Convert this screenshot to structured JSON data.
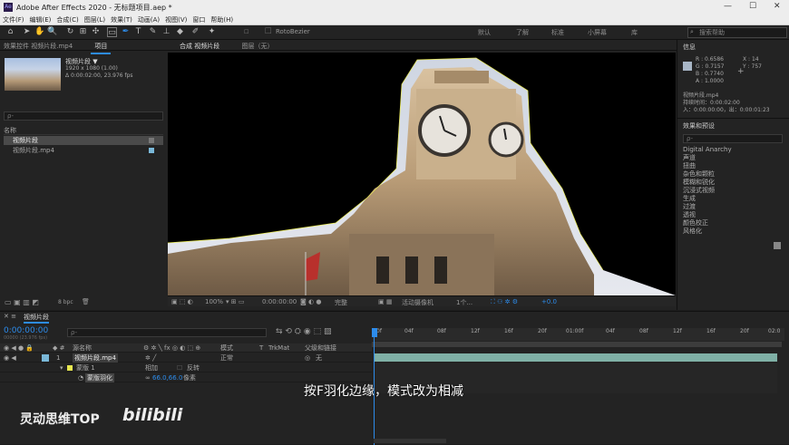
{
  "window": {
    "title": "Adobe After Effects 2020 - 无标题项目.aep *",
    "logo": "Ae",
    "minimize": "—",
    "maximize": "☐",
    "close": "✕"
  },
  "menu": [
    "文件(F)",
    "编辑(E)",
    "合成(C)",
    "图层(L)",
    "效果(T)",
    "动画(A)",
    "视图(V)",
    "窗口",
    "帮助(H)"
  ],
  "toolbar": {
    "rotobezier": "RotoBezier",
    "workspaces": [
      "默认",
      "了解",
      "标准",
      "小屏幕",
      "库"
    ],
    "search_placeholder": "搜索帮助"
  },
  "project": {
    "tabs": [
      "效果控件 视频片段.mp4",
      "项目"
    ],
    "item_name": "视频片段 ▼",
    "item_res": "1920 x 1080 (1.00)",
    "item_dur": "Δ 0:00:02:00, 23.976 fps",
    "search_placeholder": "ρ-",
    "col_name": "名称",
    "rows": [
      "视频片段",
      "视频片段.mp4"
    ],
    "bpc": "8 bpc"
  },
  "composition": {
    "tab_label": "合成 视频片段",
    "layer_tab": "图层（无）",
    "zoom": "100%",
    "time": "0:00:00:00",
    "quality": "完整",
    "camera": "活动摄像机",
    "views": "1个...",
    "offset": "+0.0"
  },
  "info": {
    "title": "信息",
    "R": "R : 0.6586",
    "G": "G : 0.7157",
    "B": "B : 0.7740",
    "A": "A : 1.0000",
    "X": "X : 14",
    "Y": "Y : 757",
    "layer": "视频片段.mp4",
    "duration": "持续时间：0:00:02:00",
    "inout": "入：0:00:00:00，出：0:00:01:23"
  },
  "effects": {
    "title": "效果和预设",
    "search_placeholder": "ρ-",
    "items": [
      "Digital Anarchy",
      "声道",
      "扭曲",
      "杂色和颗粒",
      "模糊和锐化",
      "沉浸式视频",
      "生成",
      "过渡",
      "透视",
      "颜色校正",
      "风格化"
    ]
  },
  "timeline": {
    "tab": "视频片段",
    "timecode": "0:00:00:00",
    "fps": "00000 (23.976 fps)",
    "search_placeholder": "ρ-",
    "headers": {
      "source": "源名称",
      "mode": "模式",
      "t": "T",
      "trkmat": "TrkMat",
      "parent": "父级和链接"
    },
    "layer": {
      "num": "1",
      "name": "视频片段.mp4",
      "mode": "正常",
      "parent": "无"
    },
    "mask": {
      "name": "蒙版 1",
      "mode": "相加",
      "invert": "反转"
    },
    "feather": {
      "name": "蒙版羽化",
      "value": "66.0,66.0",
      "unit": "像素"
    },
    "ruler": [
      "0f",
      "04f",
      "08f",
      "12f",
      "16f",
      "20f",
      "01:00f",
      "04f",
      "08f",
      "12f",
      "16f",
      "20f",
      "02:0"
    ]
  },
  "overlay": {
    "subtitle": "按F羽化边缘，模式改为相减",
    "brand": "灵动思维TOP",
    "bilibili": "bilibili"
  }
}
